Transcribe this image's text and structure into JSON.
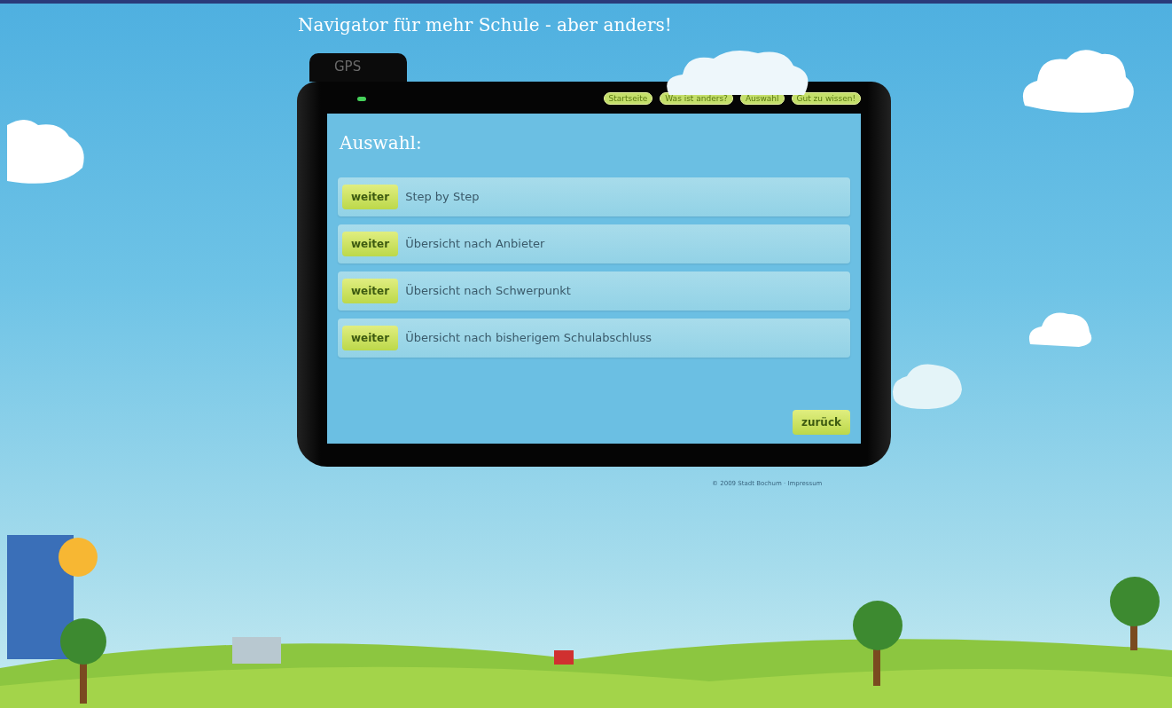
{
  "page_title": "Navigator für mehr Schule - aber anders!",
  "device": {
    "tab_label": "GPS",
    "nav": [
      "Startseite",
      "Was ist anders?",
      "Auswahl",
      "Gut zu wissen!"
    ]
  },
  "heading": "Auswahl:",
  "options": [
    {
      "button": "weiter",
      "label": "Step by Step"
    },
    {
      "button": "weiter",
      "label": "Übersicht nach Anbieter"
    },
    {
      "button": "weiter",
      "label": "Übersicht nach Schwerpunkt"
    },
    {
      "button": "weiter",
      "label": "Übersicht nach bisherigem Schulabschluss"
    }
  ],
  "back_button": "zurück",
  "footer": {
    "copyright": "© 2009 Stadt Bochum",
    "separator": "·",
    "link": "Impressum"
  }
}
